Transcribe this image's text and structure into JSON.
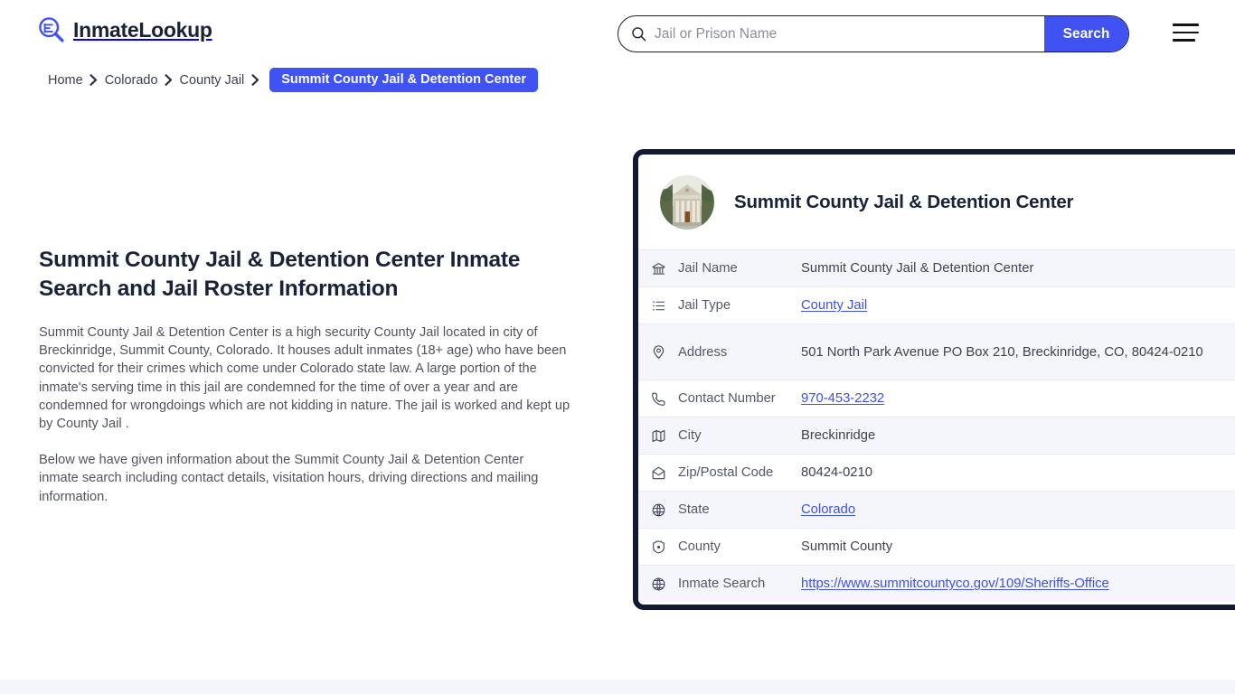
{
  "header": {
    "brand_name": "InmateLookup",
    "logo_icon": "magnifier-list-logo-icon",
    "menu_icon": "hamburger-menu-icon",
    "search": {
      "icon": "search-icon",
      "placeholder": "Jail or Prison Name",
      "value": "",
      "button_label": "Search"
    }
  },
  "breadcrumb": {
    "separator_icon": "chevron-right-icon",
    "items": [
      {
        "label": "Home",
        "current": false
      },
      {
        "label": "Colorado",
        "current": false
      },
      {
        "label": "County Jail",
        "current": false
      },
      {
        "label": "Summit County Jail & Detention Center",
        "current": true
      }
    ]
  },
  "main": {
    "page_title": "Summit County Jail & Detention Center Inmate Search and Jail Roster Information",
    "paragraph_1": "Summit County Jail & Detention Center is a high security County Jail located in city of Breckinridge, Summit County, Colorado. It houses adult inmates (18+ age) who have been convicted for their crimes which come under Colorado state law. A large portion of the inmate's serving time in this jail are condemned for the time of over a year and are condemned for wrongdoings which are not kidding in nature. The jail is worked and kept up by County Jail .",
    "paragraph_2": "Below we have given information about the Summit County Jail & Detention Center inmate search including contact details, visitation hours, driving directions and mailing information."
  },
  "info_card": {
    "photo_icon": "courthouse-building-photo",
    "title": "Summit County Jail & Detention Center",
    "rows": [
      {
        "icon": "bank-icon",
        "label": "Jail Name",
        "value": "Summit County Jail & Detention Center",
        "link": false
      },
      {
        "icon": "list-icon",
        "label": "Jail Type",
        "value": "County Jail",
        "link": true
      },
      {
        "icon": "map-pin-icon",
        "label": "Address",
        "value": "501 North Park Avenue PO Box 210, Breckinridge, CO, 80424-0210",
        "link": false
      },
      {
        "icon": "phone-icon",
        "label": "Contact Number",
        "value": "970-453-2232",
        "link": true
      },
      {
        "icon": "map-icon",
        "label": "City",
        "value": "Breckinridge",
        "link": false
      },
      {
        "icon": "envelope-icon",
        "label": "Zip/Postal Code",
        "value": "80424-0210",
        "link": false
      },
      {
        "icon": "globe-state-icon",
        "label": "State",
        "value": "Colorado",
        "link": true
      },
      {
        "icon": "badge-icon",
        "label": "County",
        "value": "Summit County",
        "link": false
      },
      {
        "icon": "globe-icon",
        "label": "Inmate Search",
        "value": "https://www.summitcountyco.gov/109/Sheriffs-Office",
        "link": true
      }
    ]
  },
  "colors": {
    "accent_blue": "#4052f2",
    "link_blue": "#3f51e0",
    "dark_navy": "#111a33",
    "row_alt": "#f5f6fc",
    "text_dark": "#1b2138",
    "text_body": "#50545f"
  }
}
